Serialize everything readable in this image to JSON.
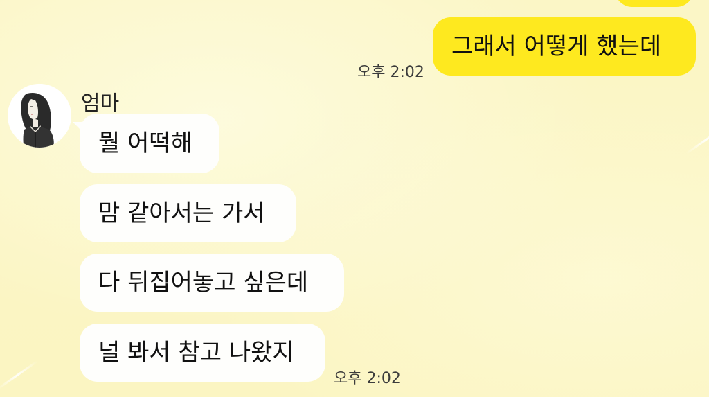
{
  "chat": {
    "contact_name": "엄마",
    "messages": [
      {
        "side": "outgoing",
        "text": ""
      },
      {
        "side": "outgoing",
        "text": "그래서 어떻게 했는데"
      },
      {
        "side": "incoming",
        "text": "뭘 어떡해"
      },
      {
        "side": "incoming",
        "text": "맘 같아서는 가서"
      },
      {
        "side": "incoming",
        "text": "다 뒤집어놓고 싶은데"
      },
      {
        "side": "incoming",
        "text": "널 봐서 참고 나왔지"
      }
    ],
    "timestamps": {
      "outgoing": "오후 2:02",
      "incoming": "오후 2:02"
    }
  },
  "colors": {
    "background": "#fbf6c4",
    "outgoing_bubble": "#fee91f",
    "incoming_bubble": "#fefefc",
    "timestamp": "#3c3c3c"
  },
  "icons": {
    "avatar": "woman-portrait-avatar-icon"
  }
}
